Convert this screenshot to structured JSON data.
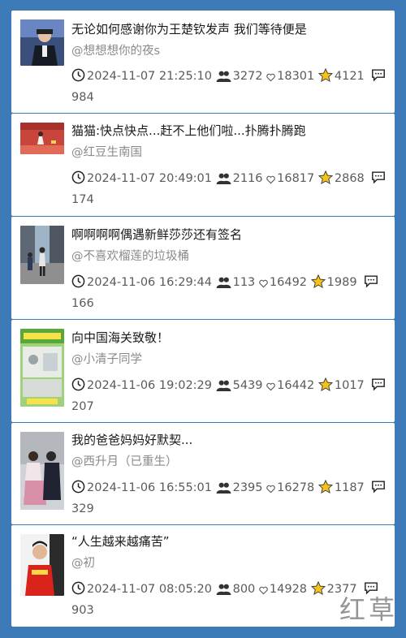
{
  "posts": [
    {
      "title": "无论如何感谢你为王楚钦发声 我们等待便是",
      "author": "@想想想你的夜s",
      "time": "2024-11-07 21:25:10",
      "views": "3272",
      "likes": "18301",
      "stars": "4121",
      "comments": "984"
    },
    {
      "title": "猫猫:快点快点...赶不上他们啦...扑腾扑腾跑",
      "author": "@红豆生南国",
      "time": "2024-11-07 20:49:01",
      "views": "2116",
      "likes": "16817",
      "stars": "2868",
      "comments": "174"
    },
    {
      "title": "啊啊啊啊偶遇新鲜莎莎还有签名",
      "author": "@不喜欢榴莲的垃圾桶",
      "time": "2024-11-06 16:29:44",
      "views": "113",
      "likes": "16492",
      "stars": "1989",
      "comments": "166"
    },
    {
      "title": "向中国海关致敬！",
      "author": "@小清子同学",
      "time": "2024-11-06 19:02:29",
      "views": "5439",
      "likes": "16442",
      "stars": "1017",
      "comments": "207"
    },
    {
      "title": "我的爸爸妈妈好默契...",
      "author": "@西升月（已重生）",
      "time": "2024-11-06 16:55:01",
      "views": "2395",
      "likes": "16278",
      "stars": "1187",
      "comments": "329"
    },
    {
      "title": "“人生越来越痛苦”",
      "author": "@初",
      "time": "2024-11-07 08:05:20",
      "views": "800",
      "likes": "14928",
      "stars": "2377",
      "comments": "903"
    }
  ],
  "icons": {
    "time": "clock-icon",
    "views": "people-icon",
    "likes": "heart-icon",
    "stars": "star-icon",
    "comments": "comment-icon"
  },
  "colors": {
    "background": "#3d7ab8",
    "star": "#f5c21b"
  },
  "watermark": "红草"
}
